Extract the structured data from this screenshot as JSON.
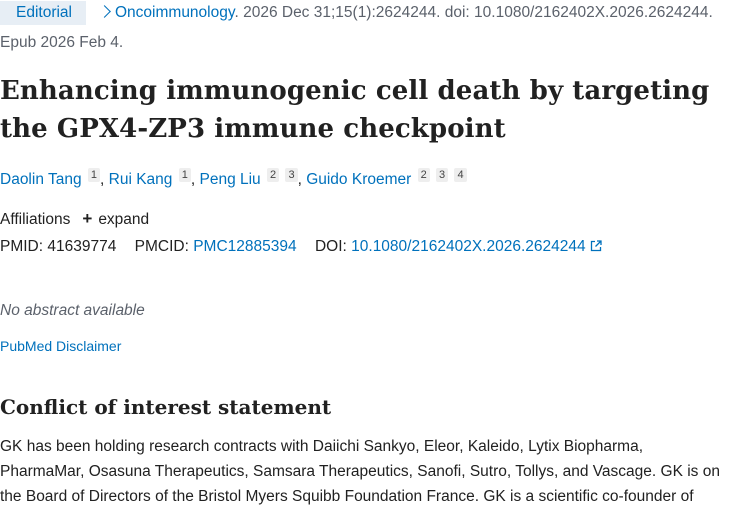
{
  "citation": {
    "type_badge": "Editorial",
    "journal": "Oncoimmunology",
    "details": ". 2026 Dec 31;15(1):2624244. doi: 10.1080/2162402X.2026.2624244.",
    "epub": "Epub 2026 Feb 4."
  },
  "article": {
    "title": "Enhancing immunogenic cell death by targeting the GPX4-ZP3 immune checkpoint"
  },
  "authors": [
    {
      "name": "Daolin Tang",
      "affils": [
        "1"
      ]
    },
    {
      "name": "Rui Kang",
      "affils": [
        "1"
      ]
    },
    {
      "name": "Peng Liu",
      "affils": [
        "2",
        "3"
      ]
    },
    {
      "name": "Guido Kroemer",
      "affils": [
        "2",
        "3",
        "4"
      ]
    }
  ],
  "affiliations": {
    "label": "Affiliations",
    "expand_label": "expand"
  },
  "identifiers": {
    "pmid_label": "PMID:",
    "pmid": "41639774",
    "pmcid_label": "PMCID:",
    "pmcid": "PMC12885394",
    "doi_label": "DOI:",
    "doi": "10.1080/2162402X.2026.2624244"
  },
  "abstract_note": "No abstract available",
  "disclaimer_link": "PubMed Disclaimer",
  "coi": {
    "heading": "Conflict of interest statement",
    "lines": [
      "GK has been holding research contracts with Daiichi Sankyo, Eleor, Kaleido, Lytix Biopharma,",
      "PharmaMar, Osasuna Therapeutics, Samsara Therapeutics, Sanofi, Sutro, Tollys, and Vascage. GK is on",
      "the Board of Directors of the Bristol Myers Squibb Foundation France. GK is a scientific co-founder of"
    ]
  },
  "icons": {
    "breadcrumb": "chevron-right-icon",
    "expand": "plus-icon",
    "external": "external-link-icon"
  },
  "colors": {
    "link": "#0071bc",
    "badge_bg": "#e7eef5",
    "muted_text": "#5b616b",
    "body_text": "#212121"
  }
}
